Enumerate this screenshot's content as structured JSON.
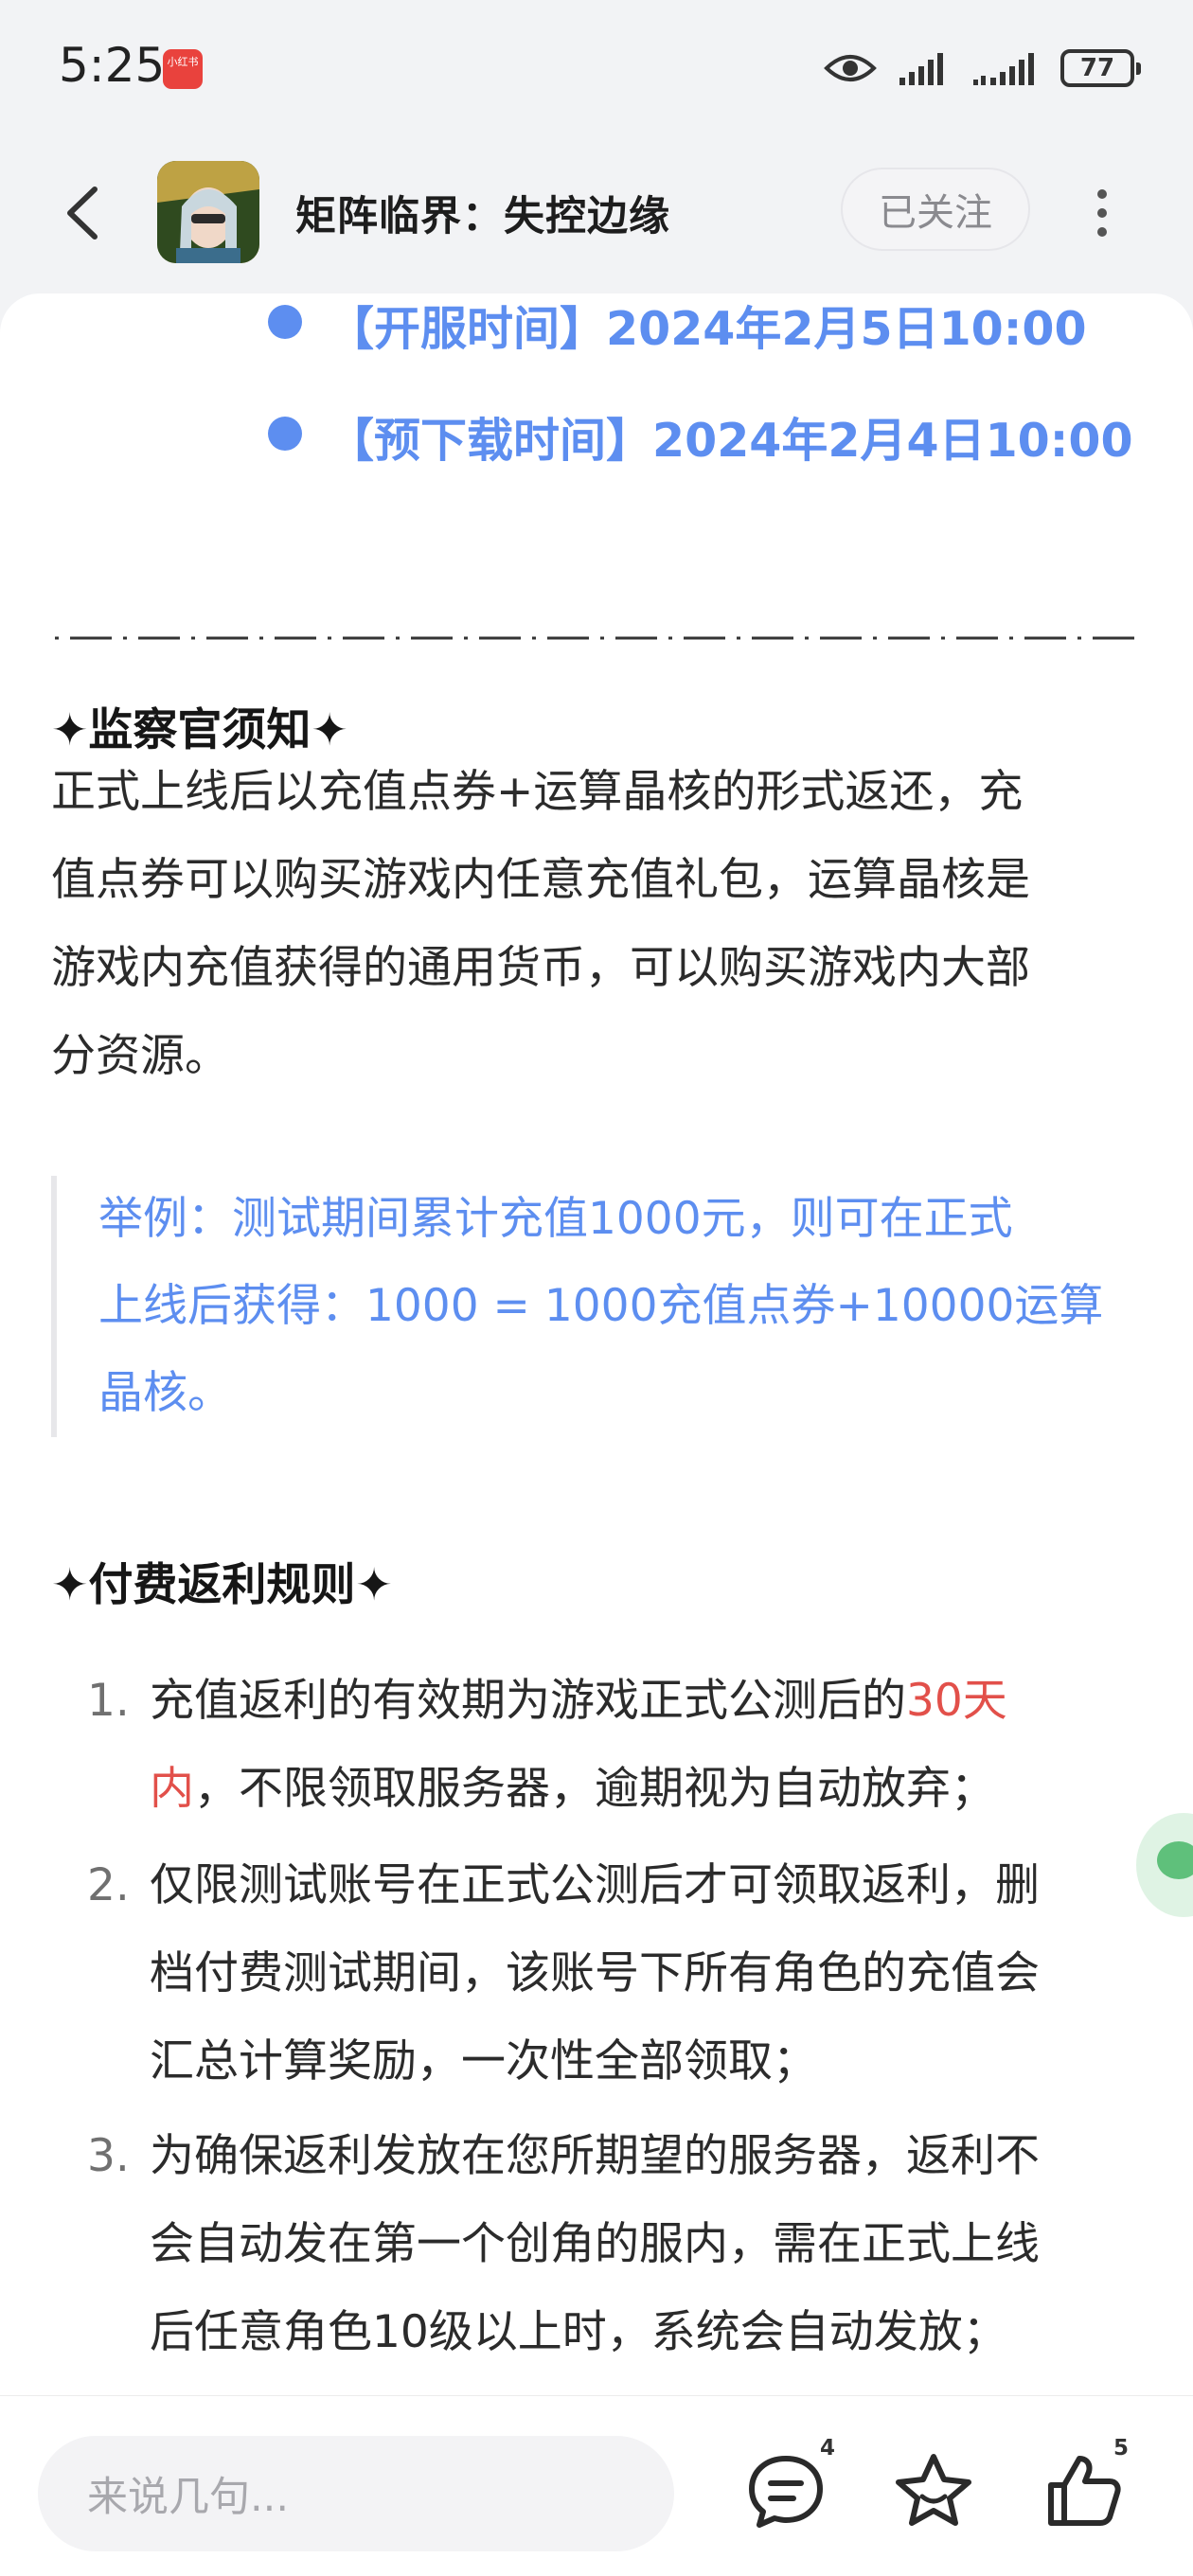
{
  "status_bar": {
    "time": "5:25",
    "notification_app": "小红书",
    "battery": "77"
  },
  "header": {
    "title": "矩阵临界：失控边缘",
    "follow_label": "已关注"
  },
  "schedule": {
    "server_open": "【开服时间】2024年2月5日10:00",
    "pre_download": "【预下载时间】2024年2月4日10:00"
  },
  "supervisor": {
    "title": "✦监察官须知✦",
    "lines": [
      "正式上线后以充值点券+运算晶核的形式返还，充",
      "值点券可以购买游戏内任意充值礼包，运算晶核是",
      "游戏内充值获得的通用货币，可以购买游戏内大部",
      "分资源。"
    ],
    "example_lines": [
      "举例：测试期间累计充值1000元，则可在正式",
      "上线后获得：1000 = 1000充值点券+10000运算",
      "晶核。"
    ]
  },
  "rebate": {
    "title": "✦付费返利规则✦",
    "rules": [
      {
        "num": "1.",
        "line1a": "充值返利的有效期为游戏正式公测后的",
        "line1b": "30天",
        "line2a": "内",
        "line2b": "，不限领取服务器，逾期视为自动放弃；"
      },
      {
        "num": "2.",
        "lines": [
          "仅限测试账号在正式公测后才可领取返利，删",
          "档付费测试期间，该账号下所有角色的充值会",
          "汇总计算奖励，一次性全部领取；"
        ]
      },
      {
        "num": "3.",
        "lines": [
          "为确保返利发放在您所期望的服务器，返利不",
          "会自动发在第一个创角的服内，需在正式上线",
          "后任意角色10级以上时，系统会自动发放；"
        ]
      }
    ]
  },
  "bottom_bar": {
    "comment_placeholder": "来说几句...",
    "comment_count": "4",
    "like_count": "5"
  },
  "colors": {
    "accent_blue": "#5d8ef0",
    "highlight_red": "#e2504a"
  },
  "icons": [
    "back-arrow-icon",
    "more-vertical-icon",
    "eye-icon",
    "signal-icon",
    "battery-icon",
    "comment-icon",
    "star-icon",
    "thumbs-up-icon"
  ]
}
